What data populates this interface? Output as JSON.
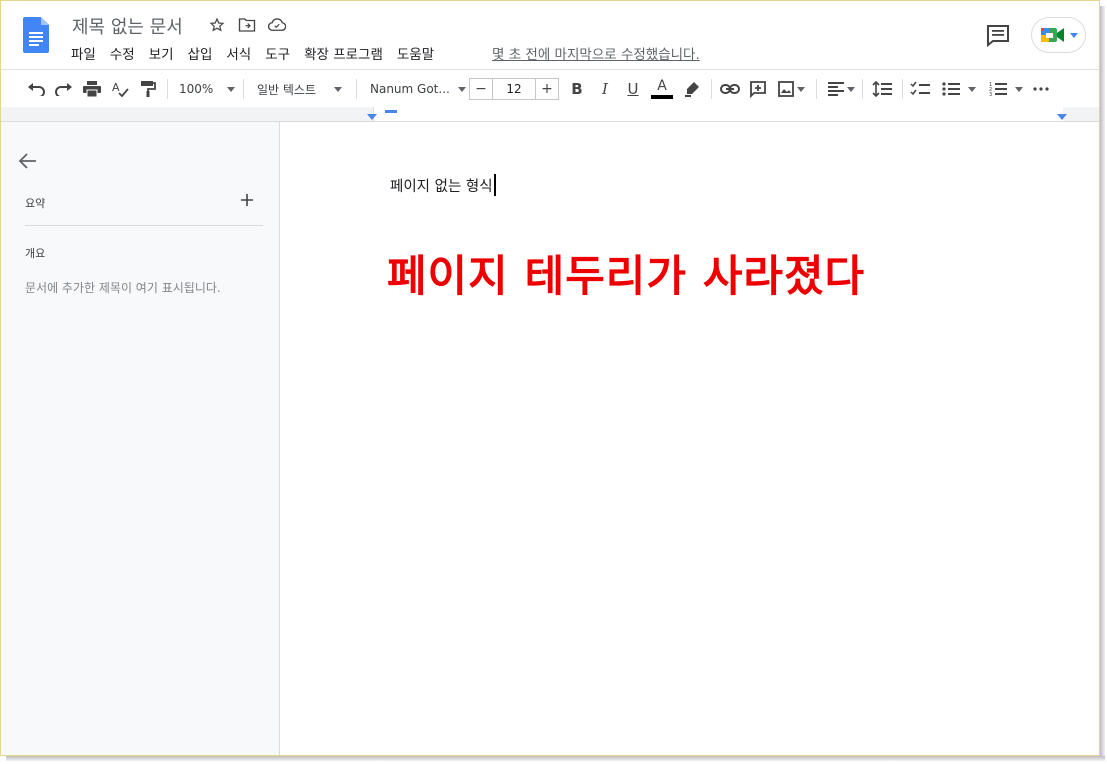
{
  "header": {
    "title": "제목 없는 문서",
    "menu": [
      "파일",
      "수정",
      "보기",
      "삽입",
      "서식",
      "도구",
      "확장 프로그램",
      "도움말"
    ],
    "last_edit": "몇 초 전에 마지막으로 수정했습니다."
  },
  "toolbar": {
    "zoom": "100%",
    "style": "일반 텍스트",
    "font": "Nanum Got...",
    "font_size": "12",
    "minus": "−",
    "plus": "+",
    "text_color": "#000000",
    "icons": [
      "undo-icon",
      "redo-icon",
      "print-icon",
      "spellcheck-icon",
      "paint-format-icon",
      "bold-icon",
      "italic-icon",
      "underline-icon",
      "text-color-icon",
      "highlight-icon",
      "link-icon",
      "add-comment-icon",
      "image-icon",
      "align-icon",
      "line-spacing-icon",
      "checklist-icon",
      "bullet-list-icon",
      "numbered-list-icon",
      "more-icon"
    ]
  },
  "sidebar": {
    "summary_label": "요약",
    "outline_label": "개요",
    "outline_hint": "문서에 추가한 제목이 여기 표시됩니다."
  },
  "document": {
    "body_text": "페이지 없는 형식",
    "overlay_text": "페이지 테두리가 사라졌다",
    "overlay_color": "#ee0000"
  },
  "colors": {
    "accent_blue": "#4285f4",
    "ruler_marker": "#4a86e8"
  }
}
